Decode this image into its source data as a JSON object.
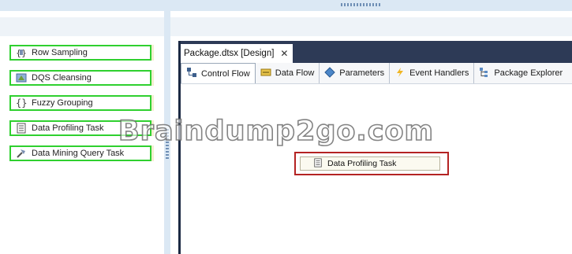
{
  "toolbox": {
    "items": [
      {
        "label": "Row Sampling",
        "icon": "row-sampling-icon"
      },
      {
        "label": "DQS Cleansing",
        "icon": "dqs-cleansing-icon"
      },
      {
        "label": "Fuzzy Grouping",
        "icon": "fuzzy-grouping-icon"
      },
      {
        "label": "Data Profiling Task",
        "icon": "data-profiling-icon"
      },
      {
        "label": "Data Mining Query Task",
        "icon": "data-mining-query-icon"
      }
    ]
  },
  "document": {
    "tab_title": "Package.dtsx [Design]",
    "close_glyph": "✕"
  },
  "designer_tabs": [
    {
      "label": "Control Flow",
      "icon": "control-flow-icon"
    },
    {
      "label": "Data Flow",
      "icon": "data-flow-icon"
    },
    {
      "label": "Parameters",
      "icon": "parameters-icon"
    },
    {
      "label": "Event Handlers",
      "icon": "event-handlers-icon"
    },
    {
      "label": "Package Explorer",
      "icon": "package-explorer-icon"
    }
  ],
  "canvas": {
    "task_label": "Data Profiling Task"
  },
  "watermark": "Braindump2go.com",
  "colors": {
    "highlight_green": "#2fd02f",
    "selection_red": "#b42323",
    "tabbar_navy": "#2d3a56"
  }
}
